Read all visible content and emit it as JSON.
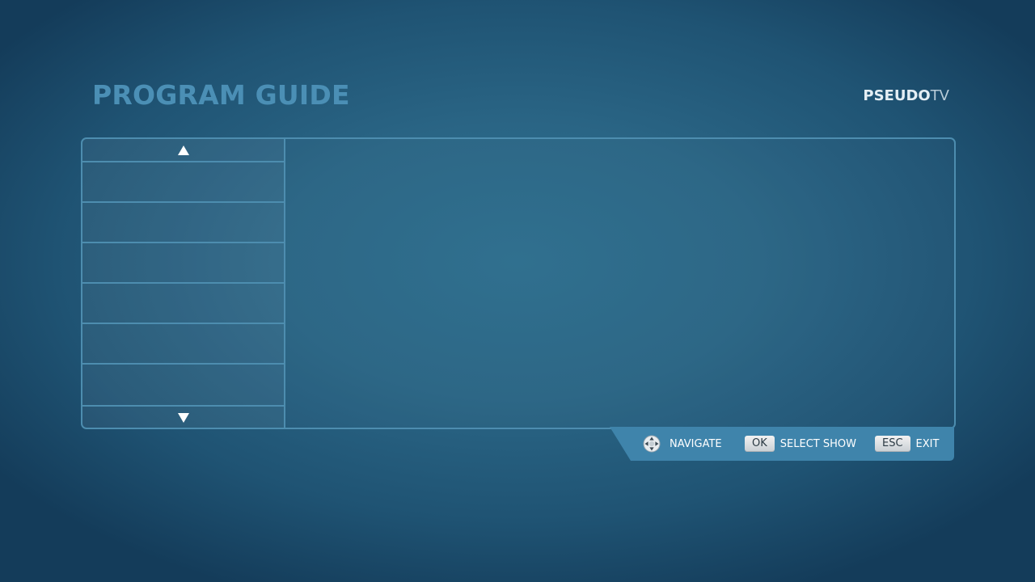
{
  "header": {
    "title": "PROGRAM GUIDE",
    "brand_bold": "PSEUDO",
    "brand_light": "TV"
  },
  "guide": {
    "scroll_up_icon": "triangle-up-icon",
    "scroll_down_icon": "triangle-down-icon",
    "channel_rows": [
      "",
      "",
      "",
      "",
      "",
      ""
    ]
  },
  "hints": {
    "navigate_icon": "dpad-icon",
    "navigate_label": "NAVIGATE",
    "ok_key": "OK",
    "ok_label": "SELECT SHOW",
    "esc_key": "ESC",
    "esc_label": "EXIT"
  },
  "colors": {
    "background": "#2a6585",
    "title": "#4b8fb5",
    "panel_border": "#4d8daf",
    "hint_bar": "#3f84ab"
  }
}
